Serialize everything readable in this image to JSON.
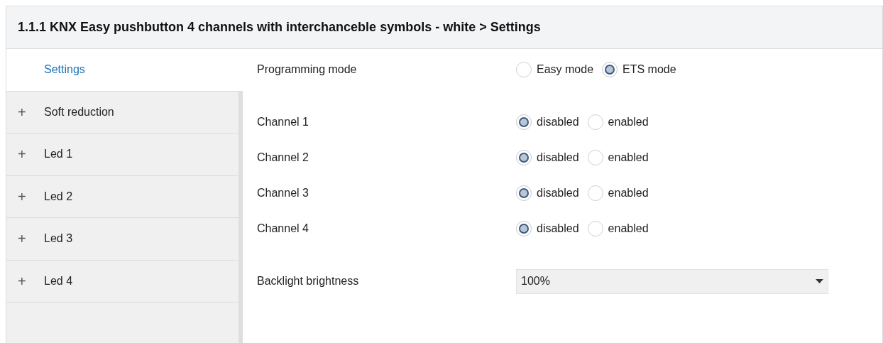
{
  "header": {
    "title": "1.1.1 KNX Easy pushbutton 4 channels with interchanceble symbols - white > Settings"
  },
  "sidebar": {
    "items": [
      {
        "label": "Settings",
        "selected": true
      },
      {
        "label": "Soft reduction",
        "selected": false,
        "expander": "+"
      },
      {
        "label": "Led 1",
        "selected": false,
        "expander": "+"
      },
      {
        "label": "Led 2",
        "selected": false,
        "expander": "+"
      },
      {
        "label": "Led 3",
        "selected": false,
        "expander": "+"
      },
      {
        "label": "Led 4",
        "selected": false,
        "expander": "+"
      }
    ]
  },
  "parameter_groups": [
    [
      {
        "kind": "radio",
        "label": "Programming mode",
        "options": [
          {
            "label": "Easy mode",
            "selected": false
          },
          {
            "label": "ETS mode",
            "selected": true
          }
        ]
      }
    ],
    [
      {
        "kind": "radio",
        "label": "Channel 1",
        "options": [
          {
            "label": "disabled",
            "selected": true
          },
          {
            "label": "enabled",
            "selected": false
          }
        ]
      },
      {
        "kind": "radio",
        "label": "Channel 2",
        "options": [
          {
            "label": "disabled",
            "selected": true
          },
          {
            "label": "enabled",
            "selected": false
          }
        ]
      },
      {
        "kind": "radio",
        "label": "Channel 3",
        "options": [
          {
            "label": "disabled",
            "selected": true
          },
          {
            "label": "enabled",
            "selected": false
          }
        ]
      },
      {
        "kind": "radio",
        "label": "Channel 4",
        "options": [
          {
            "label": "disabled",
            "selected": true
          },
          {
            "label": "enabled",
            "selected": false
          }
        ]
      }
    ],
    [
      {
        "kind": "dropdown",
        "label": "Backlight brightness",
        "value": "100%"
      }
    ]
  ]
}
